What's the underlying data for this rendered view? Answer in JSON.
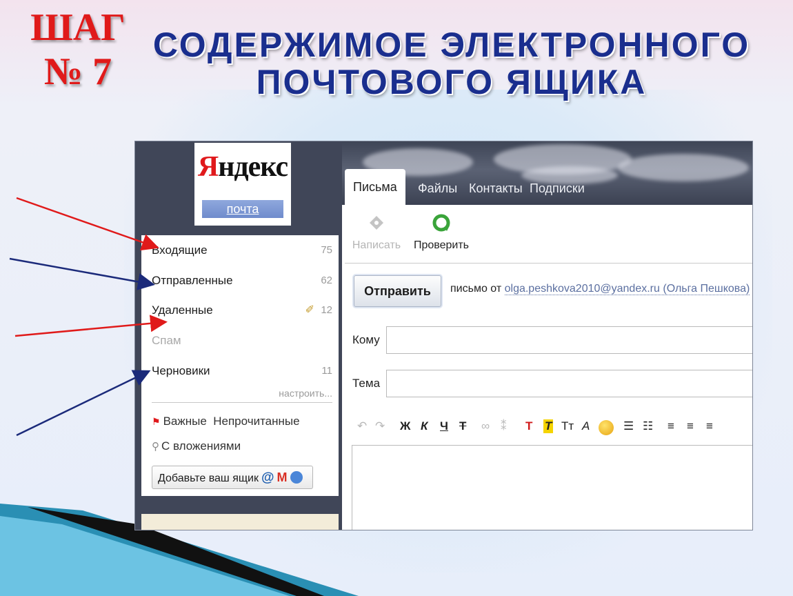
{
  "slide": {
    "step_line1": "ШАГ",
    "step_line2": "№ 7",
    "title_line1": "СОДЕРЖИМОЕ  ЭЛЕКТРОННОГО",
    "title_line2": "ПОЧТОВОГО ЯЩИКА"
  },
  "logo": {
    "brand_first": "Я",
    "brand_rest": "ндекс",
    "service": "почта"
  },
  "folders": [
    {
      "label": "Входящие",
      "count": "75"
    },
    {
      "label": "Отправленные",
      "count": "62"
    },
    {
      "label": "Удаленные",
      "count": "12",
      "icon": "broom-icon"
    },
    {
      "label": "Спам",
      "count": ""
    },
    {
      "label": "Черновики",
      "count": "11"
    }
  ],
  "sidebar": {
    "setup_link": "настроить...",
    "important": "Важные",
    "unread": "Непрочитанные",
    "attachments": "С вложениями",
    "add_box": "Добавьте ваш ящик",
    "add_box_at": "@",
    "add_box_gmail": "M"
  },
  "tabs": [
    {
      "label": "Письма",
      "active": true
    },
    {
      "label": "Файлы",
      "active": false
    },
    {
      "label": "Контакты",
      "active": false
    },
    {
      "label": "Подписки",
      "active": false
    }
  ],
  "toolbar": {
    "compose": "Написать",
    "check": "Проверить"
  },
  "compose": {
    "send": "Отправить",
    "from_prefix": "письмо от",
    "from_address": "olga.peshkova2010@yandex.ru",
    "from_name": "(Ольга Пешкова)",
    "to_label": "Кому",
    "subject_label": "Тема",
    "to_value": "",
    "subject_value": ""
  },
  "format_bar": {
    "bold": "Ж",
    "italic": "К",
    "underline": "Ч",
    "strike": "Т",
    "text_color": "Т",
    "highlight": "Т",
    "font_size": "Тт",
    "font": "А"
  },
  "colors": {
    "step_red": "#e01a1a",
    "title_blue": "#1a2e8e",
    "arrow_red": "#e01a1a",
    "arrow_navy": "#1b2a7a"
  }
}
